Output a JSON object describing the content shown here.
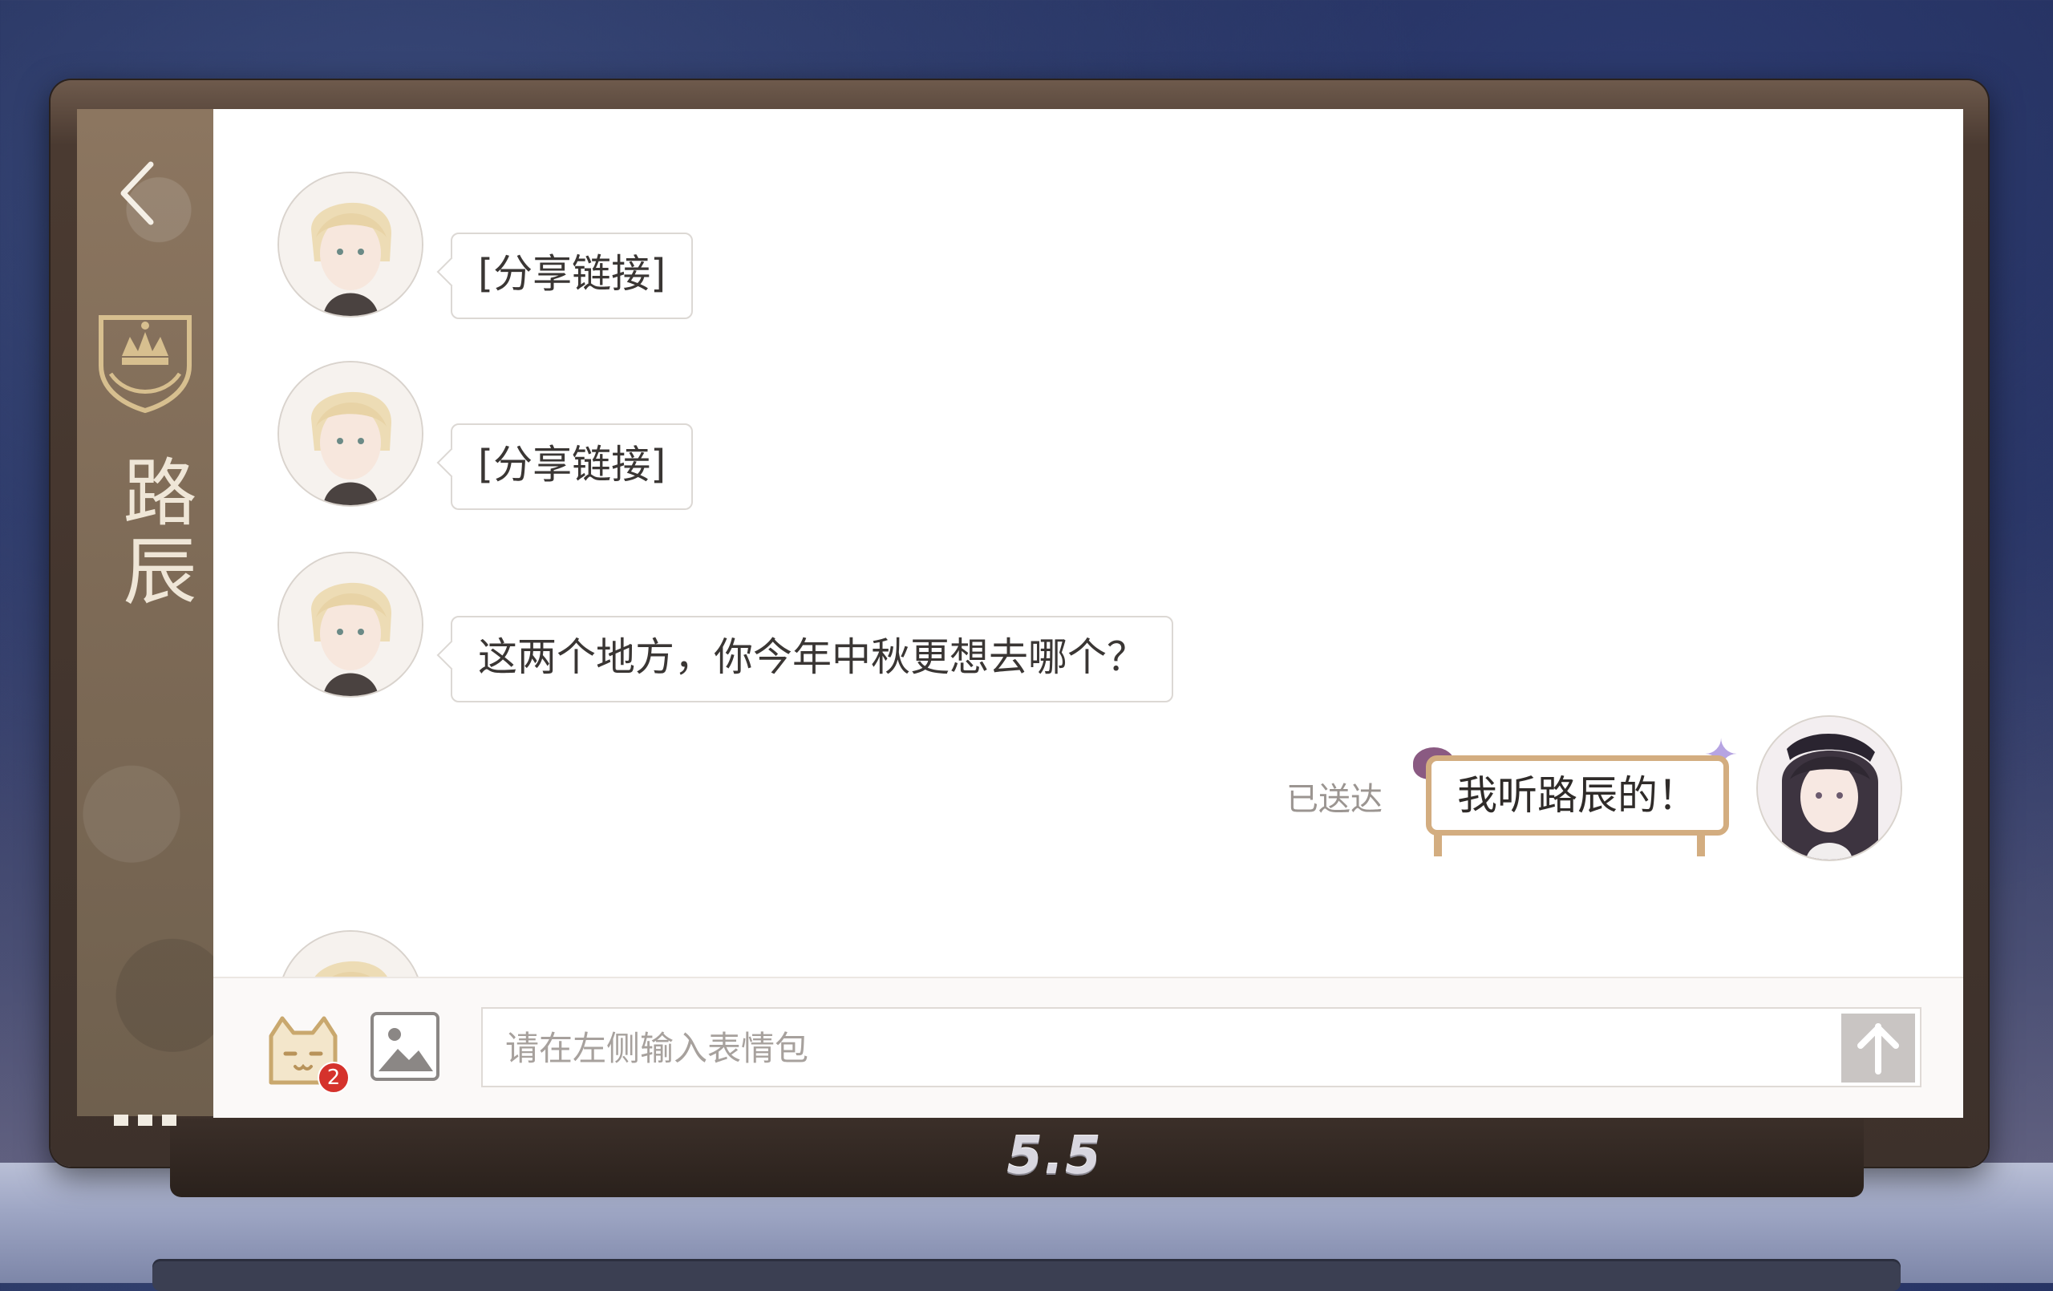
{
  "header": {
    "contact_name": "路辰"
  },
  "messages": [
    {
      "sender": "路辰",
      "text": "[分享链接]"
    },
    {
      "sender": "路辰",
      "text": "[分享链接]"
    },
    {
      "sender": "路辰",
      "text": "这两个地方，你今年中秋更想去哪个？"
    },
    {
      "sender": "me",
      "text": "我听路辰的！",
      "status": "已送达"
    }
  ],
  "input": {
    "placeholder": "请在左侧输入表情包",
    "sticker_badge": "2"
  },
  "device": {
    "logo": "5.5"
  },
  "colors": {
    "sidebar": "#7d6a56",
    "accent": "#d3ad80",
    "badge": "#d5322c"
  }
}
